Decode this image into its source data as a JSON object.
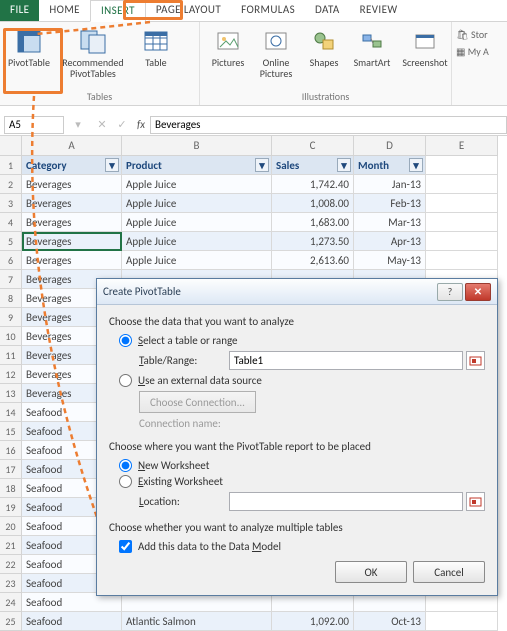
{
  "tabs": {
    "file": "FILE",
    "home": "HOME",
    "insert": "INSERT",
    "pagelayout": "PAGE LAYOUT",
    "formulas": "FORMULAS",
    "data": "DATA",
    "review": "REVIEW"
  },
  "ribbon": {
    "pivottable": "PivotTable",
    "recommended": "Recommended\nPivotTables",
    "table": "Table",
    "pictures": "Pictures",
    "onlinepics": "Online\nPictures",
    "shapes": "Shapes",
    "smartart": "SmartArt",
    "screenshot": "Screenshot",
    "grp_tables": "Tables",
    "grp_illustrations": "Illustrations",
    "store": "Stor",
    "myapps": "My A"
  },
  "fx": {
    "name": "A5",
    "value": "Beverages"
  },
  "columns": {
    "A": "Category",
    "B": "Product",
    "C": "Sales",
    "D": "Month",
    "E": "E"
  },
  "colletters": [
    "A",
    "B",
    "C",
    "D",
    "E"
  ],
  "rows": [
    {
      "n": 2,
      "a": "Beverages",
      "b": "Apple Juice",
      "c": "1,742.40",
      "d": "Jan-13"
    },
    {
      "n": 3,
      "a": "Beverages",
      "b": "Apple Juice",
      "c": "1,008.00",
      "d": "Feb-13"
    },
    {
      "n": 4,
      "a": "Beverages",
      "b": "Apple Juice",
      "c": "1,683.00",
      "d": "Mar-13"
    },
    {
      "n": 5,
      "a": "Beverages",
      "b": "Apple Juice",
      "c": "1,273.50",
      "d": "Apr-13"
    },
    {
      "n": 6,
      "a": "Beverages",
      "b": "Apple Juice",
      "c": "2,613.60",
      "d": "May-13"
    },
    {
      "n": 7,
      "a": "Beverages",
      "b": "",
      "c": "",
      "d": ""
    },
    {
      "n": 8,
      "a": "Beverages",
      "b": "",
      "c": "",
      "d": ""
    },
    {
      "n": 9,
      "a": "Beverages",
      "b": "",
      "c": "",
      "d": ""
    },
    {
      "n": 10,
      "a": "Beverages",
      "b": "",
      "c": "",
      "d": ""
    },
    {
      "n": 11,
      "a": "Beverages",
      "b": "",
      "c": "",
      "d": ""
    },
    {
      "n": 12,
      "a": "Beverages",
      "b": "",
      "c": "",
      "d": ""
    },
    {
      "n": 13,
      "a": "Beverages",
      "b": "",
      "c": "",
      "d": ""
    },
    {
      "n": 14,
      "a": "Seafood",
      "b": "",
      "c": "",
      "d": ""
    },
    {
      "n": 15,
      "a": "Seafood",
      "b": "",
      "c": "",
      "d": ""
    },
    {
      "n": 16,
      "a": "Seafood",
      "b": "",
      "c": "",
      "d": ""
    },
    {
      "n": 17,
      "a": "Seafood",
      "b": "",
      "c": "",
      "d": ""
    },
    {
      "n": 18,
      "a": "Seafood",
      "b": "",
      "c": "",
      "d": ""
    },
    {
      "n": 19,
      "a": "Seafood",
      "b": "",
      "c": "",
      "d": ""
    },
    {
      "n": 20,
      "a": "Seafood",
      "b": "",
      "c": "",
      "d": ""
    },
    {
      "n": 21,
      "a": "Seafood",
      "b": "",
      "c": "",
      "d": ""
    },
    {
      "n": 22,
      "a": "Seafood",
      "b": "",
      "c": "",
      "d": ""
    },
    {
      "n": 23,
      "a": "Seafood",
      "b": "",
      "c": "",
      "d": ""
    },
    {
      "n": 24,
      "a": "Seafood",
      "b": "",
      "c": "",
      "d": ""
    },
    {
      "n": 25,
      "a": "Seafood",
      "b": "Atlantic Salmon",
      "c": "1,092.00",
      "d": "Oct-13"
    }
  ],
  "dialog": {
    "title": "Create PivotTable",
    "sec1": "Choose the data that you want to analyze",
    "opt_table": "Select a table or range",
    "lbl_tablerange": "Table/Range:",
    "val_tablerange": "Table1",
    "opt_external": "Use an external data source",
    "btn_conn": "Choose Connection...",
    "lbl_connname": "Connection name:",
    "sec2": "Choose where you want the PivotTable report to be placed",
    "opt_newws": "New Worksheet",
    "opt_existws": "Existing Worksheet",
    "lbl_location": "Location:",
    "sec3": "Choose whether you want to analyze multiple tables",
    "chk_datamodel": "Add this data to the Data Model",
    "ok": "OK",
    "cancel": "Cancel"
  }
}
